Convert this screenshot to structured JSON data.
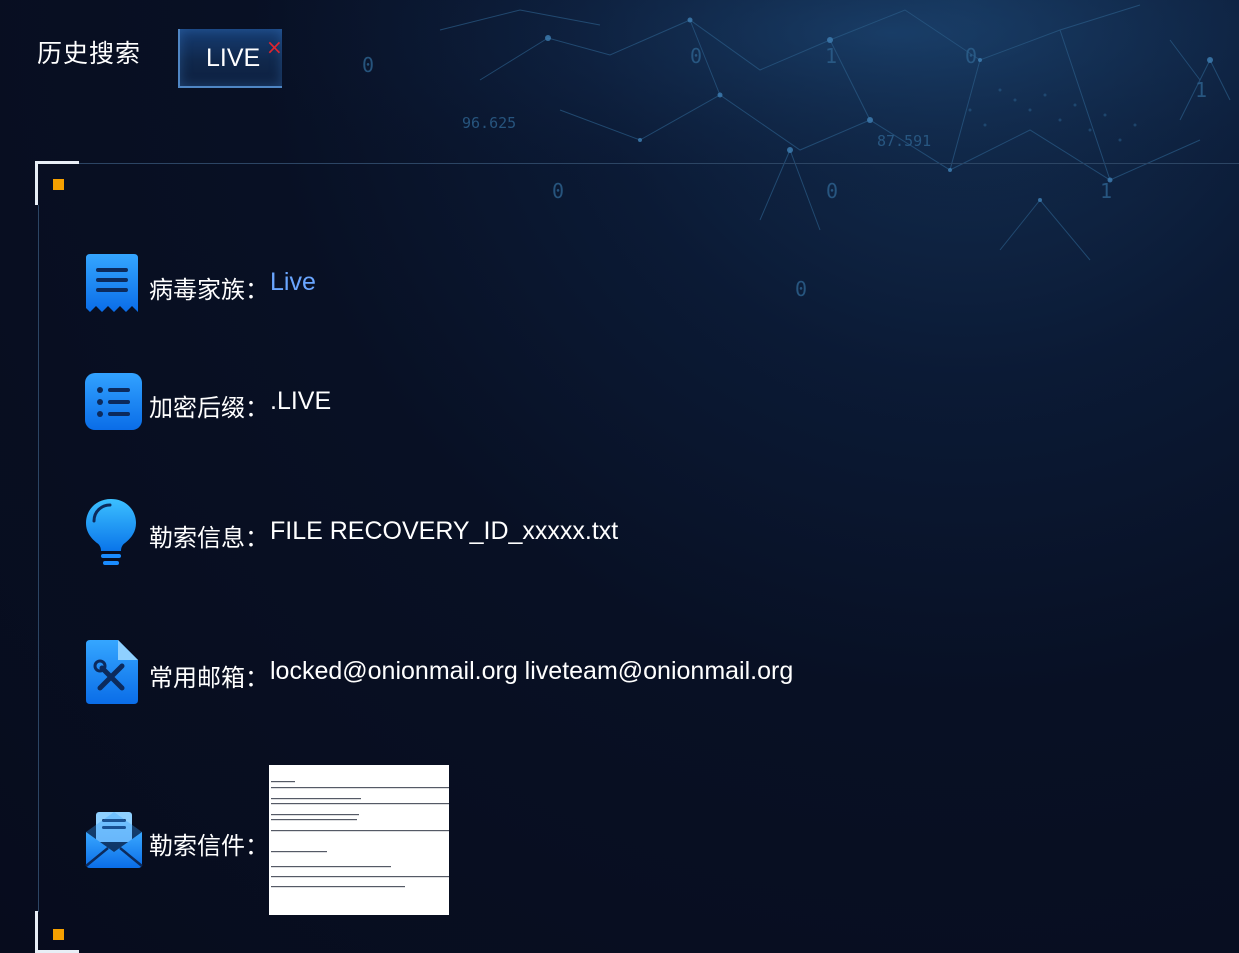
{
  "header": {
    "title": "历史搜索",
    "tag": {
      "label": "LIVE",
      "close_glyph": "×"
    }
  },
  "background_numbers": [
    "0",
    "0",
    "1",
    "0",
    "96.625",
    "87.591",
    "0",
    "0",
    "1",
    "0",
    "1"
  ],
  "details": [
    {
      "icon": "document-icon",
      "label": "病毒家族：",
      "value": "Live",
      "value_color": "#6aa6ff"
    },
    {
      "icon": "list-icon",
      "label": "加密后缀：",
      "value": ".LIVE"
    },
    {
      "icon": "lightbulb-icon",
      "label": "勒索信息：",
      "value": "FILE RECOVERY_ID_xxxxx.txt"
    },
    {
      "icon": "file-tools-icon",
      "label": "常用邮箱：",
      "value": "locked@onionmail.org liveteam@onionmail.org"
    },
    {
      "icon": "mail-icon",
      "label": "勒索信件：",
      "thumbnail": "ransom-letter-screenshot"
    }
  ],
  "colors": {
    "accent": "#6aa6ff",
    "marker": "#f5a000",
    "close": "#e0252f",
    "icon_blue": "#1a8cff"
  }
}
